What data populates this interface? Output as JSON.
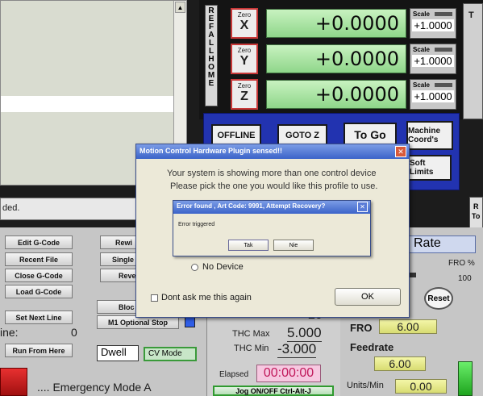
{
  "toolpath": {
    "blank": ""
  },
  "status": {
    "text": "ded."
  },
  "axes": [
    {
      "zero_top": "Zero",
      "zero_axis": "X",
      "value": "+0.0000",
      "scale_label": "Scale",
      "scale_value": "+1.0000"
    },
    {
      "zero_top": "Zero",
      "zero_axis": "Y",
      "value": "+0.0000",
      "scale_label": "Scale",
      "scale_value": "+1.0000"
    },
    {
      "zero_top": "Zero",
      "zero_axis": "Z",
      "value": "+0.0000",
      "scale_label": "Scale",
      "scale_value": "+1.0000"
    }
  ],
  "ref_all_home": [
    "R",
    "E",
    "F",
    " ",
    "A",
    "L",
    "L",
    " ",
    "H",
    "O",
    "M",
    "E"
  ],
  "top_right": {
    "t": "T"
  },
  "controls": {
    "offline": "OFFLINE",
    "gotoz": "GOTO Z",
    "togo": "To Go",
    "machine_coords": "Machine Coord's",
    "soft_limits": "Soft Limits"
  },
  "right_partial": {
    "r": "R",
    "to": "To"
  },
  "gcode_buttons": {
    "edit": "Edit G-Code",
    "recent": "Recent File",
    "close": "Close G-Code",
    "load": "Load G-Code",
    "set_next_line": "Set Next Line",
    "line_label": "ine:",
    "line_value": "0",
    "run_from_here": "Run From Here"
  },
  "mid_buttons": {
    "rewind": "Rewi",
    "single": "Single",
    "reverse": "Reve",
    "block": "Bloc",
    "m1_optional": "M1 Optional Stop",
    "dwell": "Dwell",
    "cv_mode": "CV Mode"
  },
  "thc": {
    "top_partial": "20",
    "max_label": "THC Max",
    "max_value": "5.000",
    "min_label": "THC Min",
    "min_value": "-3.000",
    "elapsed_label": "Elapsed",
    "elapsed_value": "00:00:00",
    "jog_button": "Jog ON/OFF Ctrl-Alt-J"
  },
  "feed": {
    "rate_title": "l Rate",
    "fro_pct_label": "FRO %",
    "fro_pct_value": "100",
    "reset": "Reset",
    "fro_label": "FRO",
    "fro_value": "6.00",
    "feedrate_label": "Feedrate",
    "feedrate_value": "6.00",
    "units_label": "Units/Min",
    "units_value": "0.00"
  },
  "emergency": {
    "text": ".... Emergency Mode A"
  },
  "dialog": {
    "title": "Motion Control Hardware Plugin sensed!!",
    "message_line1": "Your system is showing more than one control device",
    "message_line2": "Please pick the one you would like this profile to use.",
    "no_device": "No Device",
    "dont_ask": "Dont ask me this again",
    "ok": "OK",
    "close": "✕"
  },
  "error_dialog": {
    "title": "Error found , Art Code: 9991, Attempt Recovery?",
    "message": "Error triggered",
    "yes": "Tak",
    "no": "Nie",
    "close": "✕"
  },
  "colors": {
    "dialog_title": "#3b63c9",
    "dro_green": "#9fe09a",
    "reset_red": "#c83838",
    "estop_red": "#d02020"
  }
}
